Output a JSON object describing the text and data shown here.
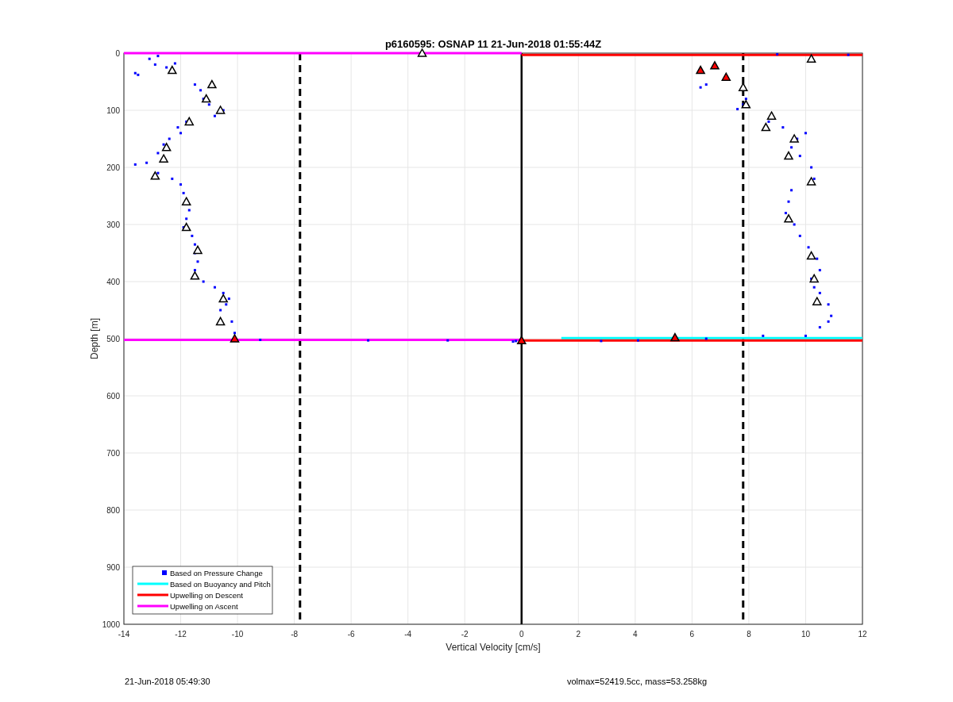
{
  "chart_data": {
    "type": "scatter",
    "title": "p6160595: OSNAP 11 21-Jun-2018 01:55:44Z",
    "xlabel": "Vertical Velocity [cm/s]",
    "ylabel": "Depth [m]",
    "xlim": [
      -14,
      12
    ],
    "ylim": [
      1000,
      0
    ],
    "xticks": [
      -14,
      -12,
      -10,
      -8,
      -6,
      -4,
      -2,
      0,
      2,
      4,
      6,
      8,
      10,
      12
    ],
    "yticks": [
      0,
      100,
      200,
      300,
      400,
      500,
      600,
      700,
      800,
      900,
      1000
    ],
    "grid": true,
    "legend": true,
    "series": [
      {
        "name": "Based on Pressure Change",
        "type": "scatter",
        "color": "#0000ff",
        "x": [
          -12.8,
          -13.1,
          -12.9,
          -13.5,
          -13.6,
          -12.5,
          -12.2,
          -11.5,
          -11.3,
          -11.2,
          -11.0,
          -10.5,
          -10.8,
          -11.8,
          -12.1,
          -12.0,
          -12.4,
          -12.6,
          -12.8,
          -13.2,
          -13.6,
          -12.8,
          -12.3,
          -12.0,
          -11.9,
          -11.7,
          -11.8,
          -11.9,
          -11.6,
          -11.5,
          -11.5,
          -11.4,
          -11.5,
          -11.2,
          -10.8,
          -10.5,
          -10.3,
          -10.4,
          -10.6,
          -10.2,
          -10.1,
          -9.2,
          -5.4,
          -2.6,
          -0.3,
          11.5,
          9.0,
          6.5,
          6.3,
          7.9,
          7.8,
          7.6,
          8.7,
          9.2,
          9.7,
          10.0,
          9.5,
          9.8,
          10.2,
          10.3,
          9.5,
          9.4,
          9.3,
          9.6,
          9.8,
          10.1,
          10.4,
          10.5,
          10.2,
          10.3,
          10.5,
          10.8,
          10.9,
          10.8,
          10.5,
          10.0,
          8.5,
          6.5,
          4.1,
          2.8,
          -0.2
        ],
        "values": [
          5,
          10,
          20,
          38,
          35,
          25,
          18,
          55,
          65,
          80,
          90,
          100,
          110,
          120,
          130,
          140,
          150,
          160,
          175,
          192,
          195,
          210,
          220,
          230,
          245,
          275,
          290,
          305,
          320,
          335,
          350,
          365,
          380,
          400,
          410,
          420,
          430,
          440,
          450,
          470,
          490,
          502,
          503,
          503,
          505,
          3,
          2,
          55,
          60,
          80,
          90,
          98,
          120,
          130,
          150,
          140,
          165,
          180,
          200,
          220,
          240,
          260,
          280,
          300,
          320,
          340,
          360,
          380,
          395,
          410,
          420,
          440,
          460,
          470,
          480,
          495,
          495,
          500,
          503,
          504,
          504
        ]
      },
      {
        "name": "Based on Buoyancy and Pitch",
        "type": "line",
        "color": "#00ffff",
        "x": [
          1.4,
          12
        ],
        "values": [
          499,
          499
        ]
      },
      {
        "name": "Upwelling on Descent",
        "type": "line",
        "color": "#ff0000",
        "x": [
          0,
          12
        ],
        "values": [
          3,
          3
        ]
      },
      {
        "name": "Upwelling on Ascent",
        "type": "line",
        "color": "#ff00ff",
        "x": [
          -14,
          0
        ],
        "values": [
          0,
          0
        ]
      },
      {
        "type": "line",
        "color": "#ff0000",
        "x": [
          0,
          12
        ],
        "values": [
          503,
          503
        ]
      },
      {
        "type": "line",
        "color": "#ff00ff",
        "x": [
          -14,
          0
        ],
        "values": [
          502,
          502
        ]
      },
      {
        "type": "scatter",
        "marker": "triangle",
        "color": "#ffffff",
        "x": [
          -12.3,
          -10.9,
          -11.1,
          -10.6,
          -11.7,
          -12.5,
          -12.6,
          -12.9,
          -11.8,
          -11.8,
          -11.4,
          -11.5,
          -10.5,
          -10.6,
          -3.5,
          10.2,
          7.8,
          7.9,
          8.8,
          8.6,
          9.6,
          9.4,
          10.2,
          9.4,
          10.2,
          10.3,
          10.4
        ],
        "values": [
          30,
          55,
          80,
          100,
          120,
          165,
          185,
          215,
          260,
          305,
          345,
          390,
          430,
          470,
          0,
          10,
          60,
          90,
          110,
          130,
          150,
          180,
          225,
          290,
          355,
          395,
          435
        ]
      },
      {
        "type": "scatter",
        "marker": "triangle",
        "color": "#ff0000",
        "x": [
          6.3,
          6.8,
          7.2,
          5.4,
          -10.1,
          0
        ],
        "values": [
          30,
          22,
          42,
          498,
          500,
          503
        ]
      }
    ],
    "ref_lines": [
      {
        "axis": "x",
        "value": -7.8
      },
      {
        "axis": "x",
        "value": 7.8
      },
      {
        "axis": "x",
        "value": 0
      }
    ]
  },
  "footer": {
    "left": "21-Jun-2018 05:49:30",
    "right": "volmax=52419.5cc, mass=53.258kg"
  }
}
